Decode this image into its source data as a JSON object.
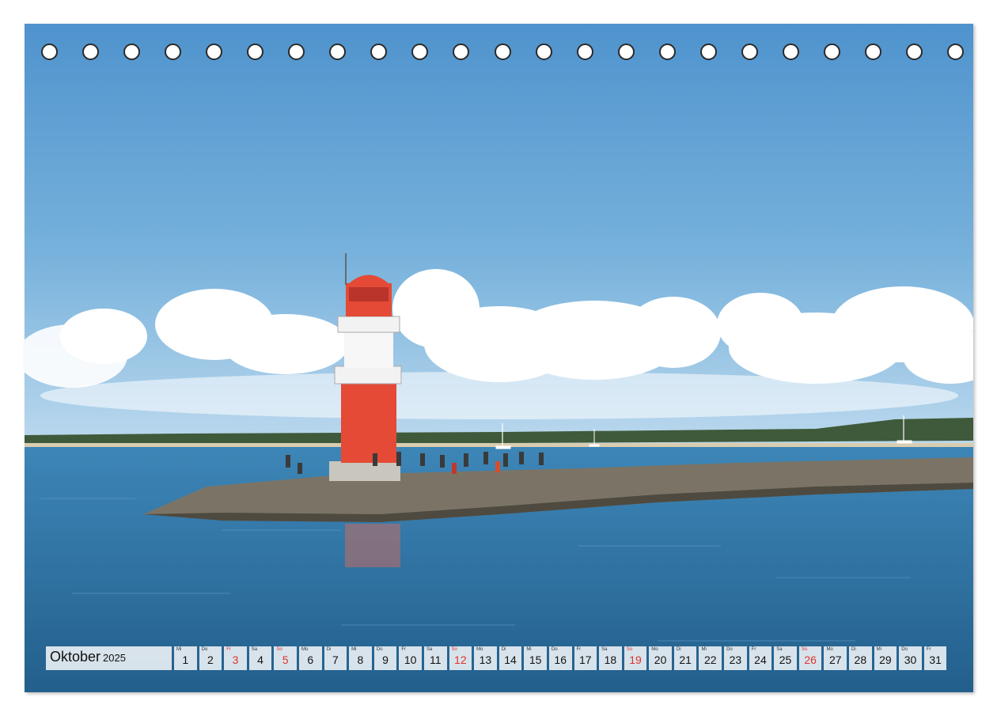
{
  "calendar": {
    "month": "Oktober",
    "year": "2025",
    "days": [
      {
        "wd": "Mi",
        "n": "1"
      },
      {
        "wd": "Do",
        "n": "2"
      },
      {
        "wd": "Fr",
        "n": "3",
        "red": true
      },
      {
        "wd": "Sa",
        "n": "4"
      },
      {
        "wd": "So",
        "n": "5",
        "red": true
      },
      {
        "wd": "Mo",
        "n": "6"
      },
      {
        "wd": "Di",
        "n": "7"
      },
      {
        "wd": "Mi",
        "n": "8"
      },
      {
        "wd": "Do",
        "n": "9"
      },
      {
        "wd": "Fr",
        "n": "10"
      },
      {
        "wd": "Sa",
        "n": "11"
      },
      {
        "wd": "So",
        "n": "12",
        "red": true
      },
      {
        "wd": "Mo",
        "n": "13"
      },
      {
        "wd": "Di",
        "n": "14"
      },
      {
        "wd": "Mi",
        "n": "15"
      },
      {
        "wd": "Do",
        "n": "16"
      },
      {
        "wd": "Fr",
        "n": "17"
      },
      {
        "wd": "Sa",
        "n": "18"
      },
      {
        "wd": "So",
        "n": "19",
        "red": true
      },
      {
        "wd": "Mo",
        "n": "20"
      },
      {
        "wd": "Di",
        "n": "21"
      },
      {
        "wd": "Mi",
        "n": "22"
      },
      {
        "wd": "Do",
        "n": "23"
      },
      {
        "wd": "Fr",
        "n": "24"
      },
      {
        "wd": "Sa",
        "n": "25"
      },
      {
        "wd": "So",
        "n": "26",
        "red": true
      },
      {
        "wd": "Mo",
        "n": "27"
      },
      {
        "wd": "Di",
        "n": "28"
      },
      {
        "wd": "Mi",
        "n": "29"
      },
      {
        "wd": "Do",
        "n": "30"
      },
      {
        "wd": "Fr",
        "n": "31"
      }
    ]
  },
  "binding": {
    "hole_count": 23
  },
  "colors": {
    "holiday_red": "#e0322b",
    "sky": "#5fa0d4",
    "sea": "#2d77a7",
    "lighthouse_red": "#e44a35"
  }
}
